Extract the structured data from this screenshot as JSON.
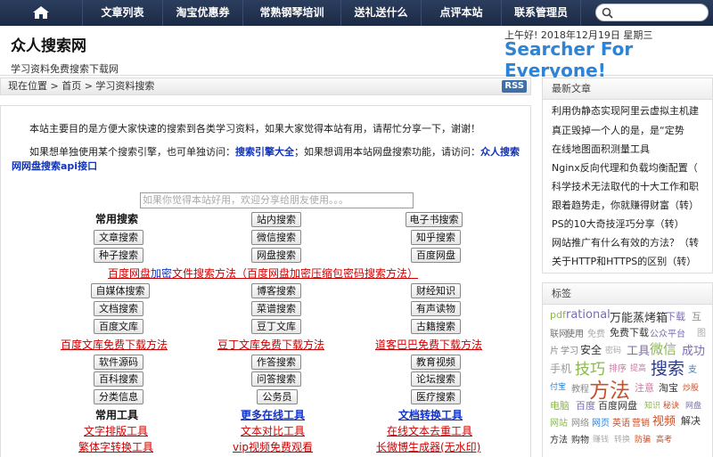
{
  "nav": {
    "items": [
      "文章列表",
      "淘宝优惠券",
      "常熟钢琴培训",
      "送礼送什么",
      "点评本站",
      "联系管理员"
    ]
  },
  "header": {
    "site_name": "众人搜索网",
    "site_desc": "学习资料免费搜索下载网",
    "date": "上午好! 2018年12月19日 星期三",
    "slogan": "Searcher For Everyone!"
  },
  "breadcrumb": {
    "text": "现在位置 > 首页 > 学习资料搜索",
    "rss": "RSS"
  },
  "intro": {
    "p1": "本站主要目的是方便大家快速的搜索到各类学习资料，如果大家觉得本站有用，请帮忙分享一下，谢谢！",
    "p2a": "如果想单独使用某个搜索引擎，也可单独访问：",
    "p2b": "搜索引擎大全",
    "p2c": "；如果想调用本站网盘搜索功能，请访问：",
    "p2d": "众人搜索网",
    "p2e": "网盘搜索api接口"
  },
  "share": {
    "placeholder": "如果你觉得本站好用，欢迎分享给朋友使用。。。"
  },
  "heads": {
    "common": "常用搜索",
    "tools": "常用工具",
    "online": "更多在线工具",
    "convert": "文档转换工具"
  },
  "buttons": {
    "site": "站内搜索",
    "ebook": "电子书搜索",
    "article": "文章搜索",
    "wechat": "微信搜索",
    "zhihu": "知乎搜索",
    "torrent": "种子搜索",
    "pan": "网盘搜索",
    "baidupan": "百度网盘",
    "media": "自媒体搜索",
    "blog": "博客搜索",
    "finance": "财经知识",
    "doc": "文档搜索",
    "bean": "菜谱搜索",
    "audio": "有声读物",
    "wenku": "百度文库",
    "doding": "豆丁文库",
    "ancient": "古籍搜索",
    "software": "软件源码",
    "tool": "作答搜索",
    "edu": "教育视频",
    "baike": "百科搜索",
    "qa": "问答搜索",
    "forum": "论坛搜索",
    "cat": "分类信息",
    "gov": "公务员",
    "medical": "医疗搜索"
  },
  "links": {
    "pan_a": "百度网盘",
    "pan_b": "加密",
    "pan_c": "文件搜索方法（百度网盘加密压缩包密码搜索方法）",
    "wenku_dl": "百度文库免费下载方法",
    "doding_dl": "豆丁文库免费下载方法",
    "daoke_dl": "道客巴巴免费下载方法",
    "tool1": "文字排版工具",
    "tool2": "繁体字转换工具",
    "online1": "文本对比工具",
    "online2": "vip视频免费观看",
    "conv1": "在线文本去重工具",
    "conv2": "长微博生成器(无水印)"
  },
  "recent": {
    "title": "最新文章",
    "items": [
      "利用伪静态实现阿里云虚拟主机建",
      "真正毁掉一个人的是，是“定势",
      "在线地图面积测量工具",
      "Nginx反向代理和负载均衡配置（",
      "科学技术无法取代的十大工作和职",
      "跟着趋势走，你就赚得财富（转）",
      "PS的10大奇技淫巧分享（转）",
      "网站推广有什么有效的方法？（转",
      "关于HTTP和HTTPS的区别（转）"
    ]
  },
  "tags": {
    "title": "标签",
    "items": [
      "pdf",
      "rational",
      "万能蒸烤箱",
      "下载",
      "互",
      "联网",
      "使用",
      "免费",
      "免费下载",
      "公众平台",
      "图",
      "片",
      "学习",
      "安全",
      "密码",
      "工具",
      "微信",
      "成功",
      "手机",
      "技巧",
      "排序",
      "提高",
      "搜索",
      "支",
      "付宝",
      "教程",
      "方法",
      "注意",
      "淘宝",
      "炒股",
      "电脑",
      "百度",
      "百度网盘",
      "知识",
      "秘诀",
      "网盘",
      "网站",
      "网络",
      "网页",
      "英语",
      "营销",
      "视频",
      "解决",
      "方法",
      "购物",
      "赚钱",
      "转换",
      "防骗",
      "高考"
    ]
  },
  "colors": {
    "nav": "#1f2e4b",
    "slogan": "#2d83d6",
    "link_red": "#cc0000",
    "link_blue": "#1133cc"
  }
}
